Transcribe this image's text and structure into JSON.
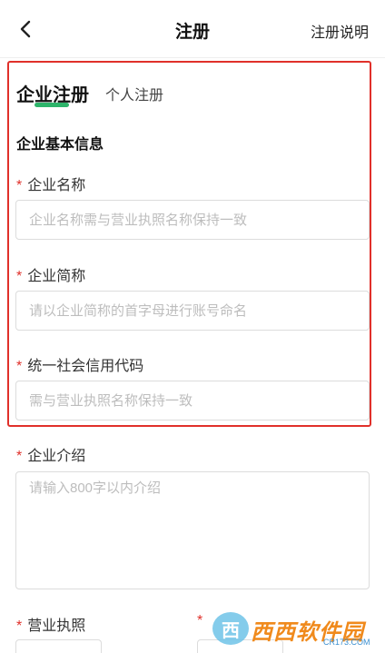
{
  "header": {
    "title": "注册",
    "right_link": "注册说明"
  },
  "tabs": {
    "active": "企业注册",
    "inactive": "个人注册"
  },
  "section": {
    "title": "企业基本信息"
  },
  "required_mark": "*",
  "fields": {
    "name": {
      "label": "企业名称",
      "placeholder": "企业名称需与营业执照名称保持一致"
    },
    "short_name": {
      "label": "企业简称",
      "placeholder": "请以企业简称的首字母进行账号命名"
    },
    "credit_code": {
      "label": "统一社会信用代码",
      "placeholder": "需与营业执照名称保持一致"
    },
    "intro": {
      "label": "企业介绍",
      "placeholder": "请输入800字以内介绍"
    },
    "license": {
      "label": "营业执照"
    },
    "second": {
      "label": ""
    }
  },
  "watermark": {
    "mark": "西",
    "text": "西西软件园",
    "sub": "CR173.COM"
  },
  "colors": {
    "required": "#e0302a",
    "tab_underline": "#2db46a",
    "highlight_border": "#e0302a"
  }
}
